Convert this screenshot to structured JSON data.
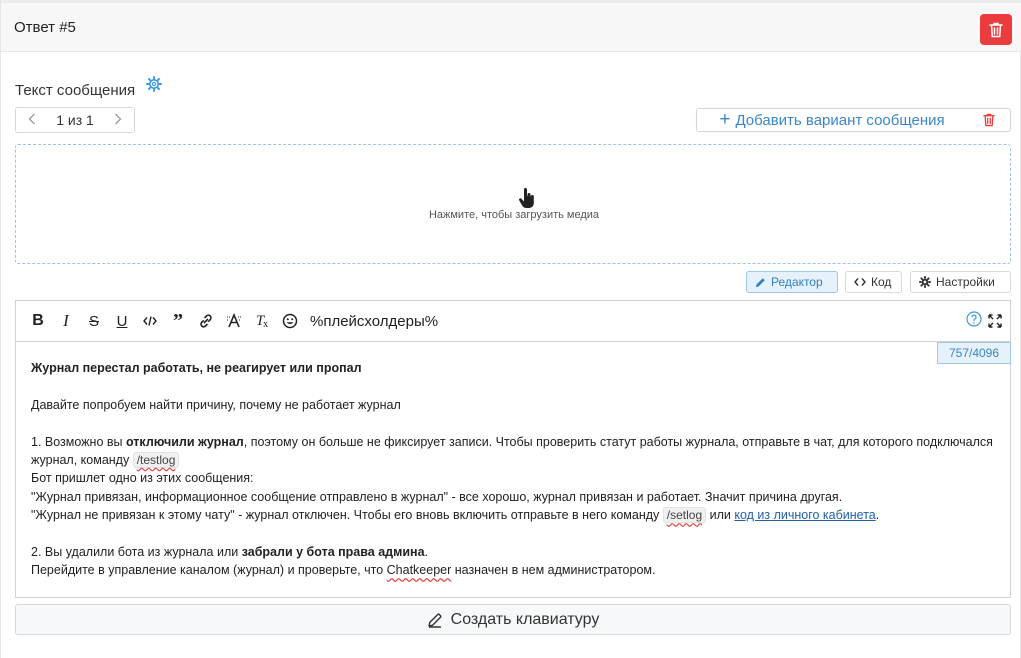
{
  "header": {
    "title": "Ответ #5"
  },
  "message_section": {
    "label": "Текст сообщения",
    "pager": {
      "current": "1",
      "sep": "из",
      "total": "1"
    },
    "add_variant_label": "Добавить вариант сообщения",
    "upload_hint": "Нажмите, чтобы загрузить медиа"
  },
  "mode_tabs": {
    "editor": "Редактор",
    "code": "Код",
    "settings": "Настройки"
  },
  "toolbar": {
    "placeholders": "%плейсхолдеры%",
    "counter": "757/4096"
  },
  "content": {
    "p1": "Журнал перестал работать, не реагирует или пропал",
    "p2": "Давайте попробуем найти причину, почему не работает журнал",
    "p3_a": "1. Возможно вы ",
    "p3_b": "отключили журнал",
    "p3_c": ", поэтому он больше не фиксирует записи. Чтобы проверить статут работы журнала, отправьте в чат, для которого подключался журнал, команду ",
    "p3_cmd": "/testlog",
    "p4": "Бот пришлет одно из этих сообщения:",
    "p5": "\"Журнал привязан, информационное сообщение отправлено в журнал\" - все хорошо, журнал привязан и работает. Значит причина другая.",
    "p6_a": "\"Журнал не привязан к этому чату\" - журнал отключен. Чтобы его вновь включить отправьте в него команду ",
    "p6_cmd": "/setlog",
    "p6_b": " или ",
    "p6_link": "код из личного кабинета",
    "p6_c": ".",
    "p7_a": "2. Вы удалили бота из журнала или ",
    "p7_b": "забрали у бота права админа",
    "p7_c": ".",
    "p8_a": "Перейдите в управление каналом (журнал) и проверьте, что ",
    "p8_b": "Chatkeeper",
    "p8_c": " назначен в нем администратором."
  },
  "keyboard_button": {
    "label": "Создать клавиатуру"
  },
  "colors": {
    "accent": "#3a86c8",
    "danger": "#ea3c3c",
    "link": "#1f5fa8"
  }
}
